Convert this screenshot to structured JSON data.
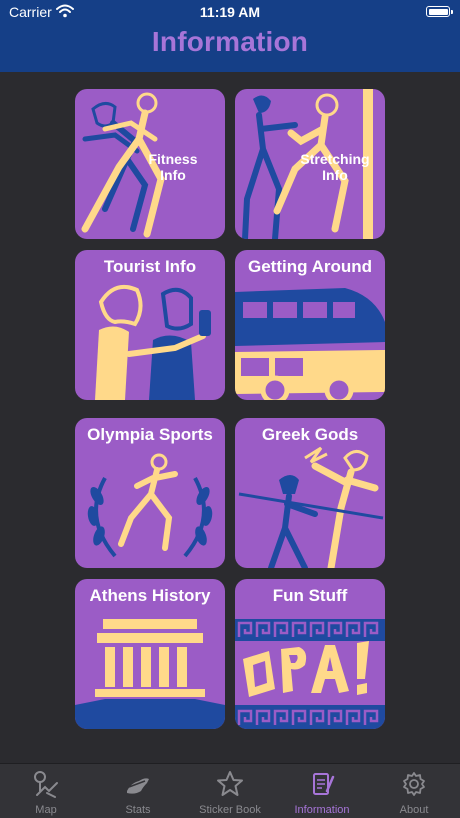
{
  "status_bar": {
    "carrier": "Carrier",
    "time": "11:19 AM"
  },
  "nav": {
    "title": "Information"
  },
  "colors": {
    "nav_bar": "#153f87",
    "background": "#2b2b2f",
    "tile": "#9b5cc6",
    "accent": "#a775d8",
    "art_blue": "#1f4aa0",
    "art_yellow": "#ffd98a",
    "tabbar": "#333337",
    "tab_inactive": "#8a8a8f"
  },
  "tiles": [
    {
      "label": "Fitness\nInfo",
      "icon": "runners-icon"
    },
    {
      "label": "Stretching\nInfo",
      "icon": "stretching-icon"
    },
    {
      "label": "Tourist Info",
      "icon": "tourists-icon"
    },
    {
      "label": "Getting Around",
      "icon": "bus-icon"
    },
    {
      "label": "Olympia Sports",
      "icon": "laurel-runner-icon"
    },
    {
      "label": "Greek Gods",
      "icon": "javelin-god-icon"
    },
    {
      "label": "Athens History",
      "icon": "temple-icon"
    },
    {
      "label": "Fun Stuff",
      "icon": "opa-icon"
    }
  ],
  "tabs": [
    {
      "label": "Map",
      "icon": "map-pin-icon"
    },
    {
      "label": "Stats",
      "icon": "shoe-icon"
    },
    {
      "label": "Sticker Book",
      "icon": "star-icon"
    },
    {
      "label": "Information",
      "icon": "document-pencil-icon"
    },
    {
      "label": "About",
      "icon": "gear-icon"
    }
  ],
  "active_tab": "Information"
}
